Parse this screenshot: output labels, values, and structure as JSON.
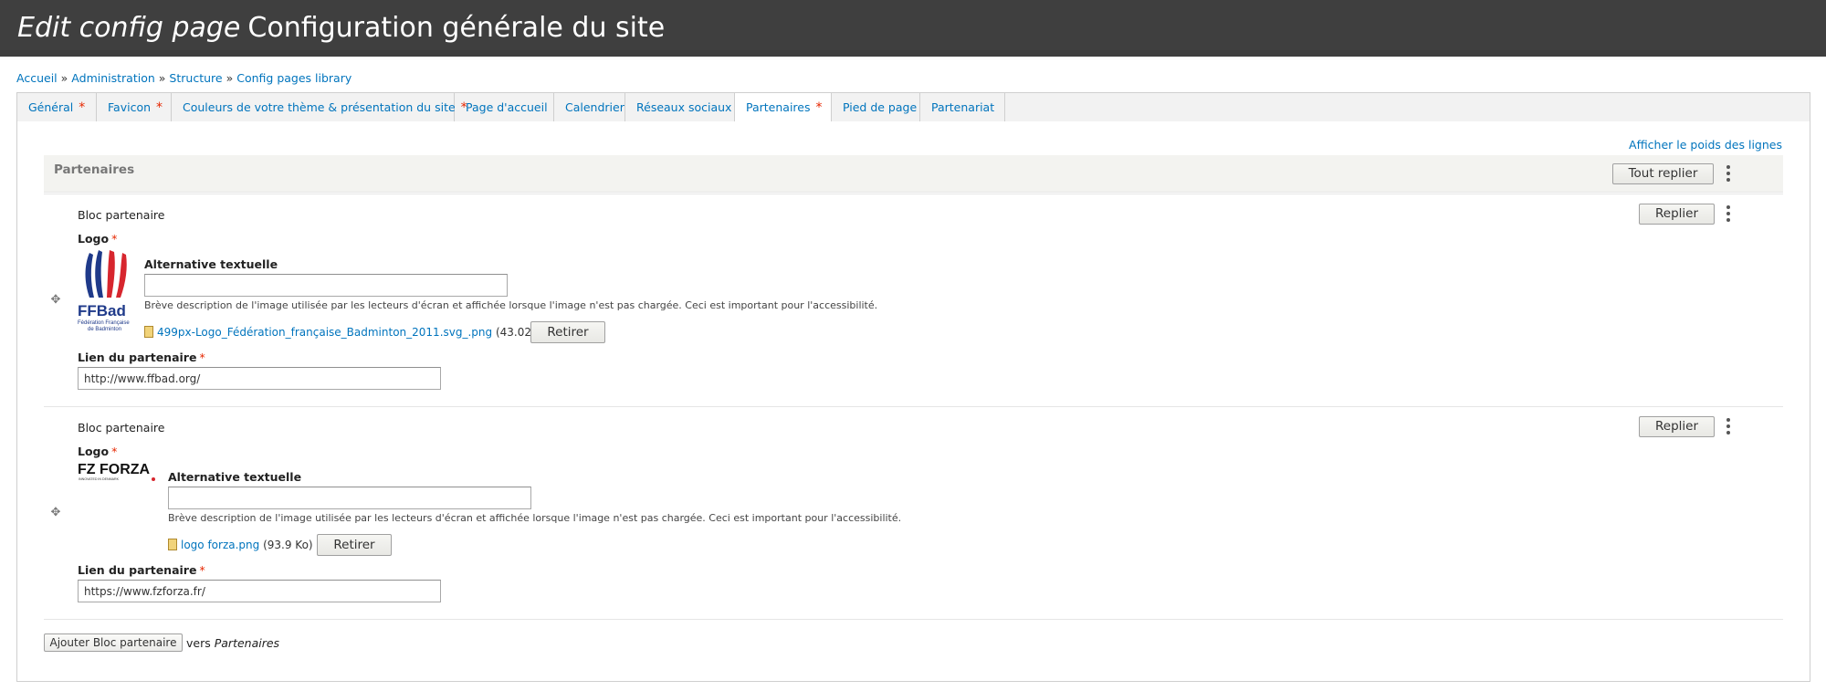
{
  "header": {
    "title_italic": "Edit config page",
    "title": "Configuration générale du site"
  },
  "breadcrumb": [
    "Accueil",
    "Administration",
    "Structure",
    "Config pages library"
  ],
  "breadcrumb_separator": "»",
  "tabs": [
    {
      "label": "Général",
      "required": true
    },
    {
      "label": "Favicon",
      "required": true
    },
    {
      "label": "Couleurs de votre thème & présentation du site",
      "required": true
    },
    {
      "label": "Page d'accueil",
      "required": false
    },
    {
      "label": "Calendrier",
      "required": false
    },
    {
      "label": "Réseaux sociaux",
      "required": false
    },
    {
      "label": "Partenaires",
      "required": true,
      "active": true
    },
    {
      "label": "Pied de page",
      "required": false
    },
    {
      "label": "Partenariat",
      "required": false
    }
  ],
  "required_mark": "*",
  "toggle_weights": "Afficher le poids des lignes",
  "section": {
    "label": "Partenaires",
    "collapse_all": "Tout replier"
  },
  "blocks": [
    {
      "title": "Bloc partenaire",
      "collapse": "Replier",
      "logo_label": "Logo",
      "logo_name": "FFBad logo",
      "alt_label": "Alternative textuelle",
      "alt_value": "",
      "alt_description": "Brève description de l'image utilisée par les lecteurs d'écran et affichée lorsque l'image n'est pas chargée. Ceci est important pour l'accessibilité.",
      "file_name": "499px-Logo_Fédération_française_Badminton_2011.svg_.png",
      "file_size": "(43.02 Ko)",
      "remove": "Retirer",
      "link_label": "Lien du partenaire",
      "link_value": "http://www.ffbad.org/"
    },
    {
      "title": "Bloc partenaire",
      "collapse": "Replier",
      "logo_label": "Logo",
      "logo_name": "FZ Forza logo",
      "alt_label": "Alternative textuelle",
      "alt_value": "",
      "alt_description": "Brève description de l'image utilisée par les lecteurs d'écran et affichée lorsque l'image n'est pas chargée. Ceci est important pour l'accessibilité.",
      "file_name": "logo forza.png",
      "file_size": "(93.9 Ko)",
      "remove": "Retirer",
      "link_label": "Lien du partenaire",
      "link_value": "https://www.fzforza.fr/"
    }
  ],
  "logos": {
    "ffbad_text": "FFBad",
    "ffbad_sub1": "Fédération Française",
    "ffbad_sub2": "de Badminton",
    "forza_text": "FZ FORZA",
    "forza_sub": "INNOVATED IN DENMARK"
  },
  "add_button": "Ajouter Bloc partenaire",
  "add_suffix_prefix": "vers",
  "add_suffix_target": "Partenaires",
  "colors": {
    "header_bg": "#3f3f3f",
    "link": "#0074bd",
    "required": "#e62600",
    "ffbad_blue": "#1f3a8a",
    "ffbad_red": "#d7262e"
  }
}
